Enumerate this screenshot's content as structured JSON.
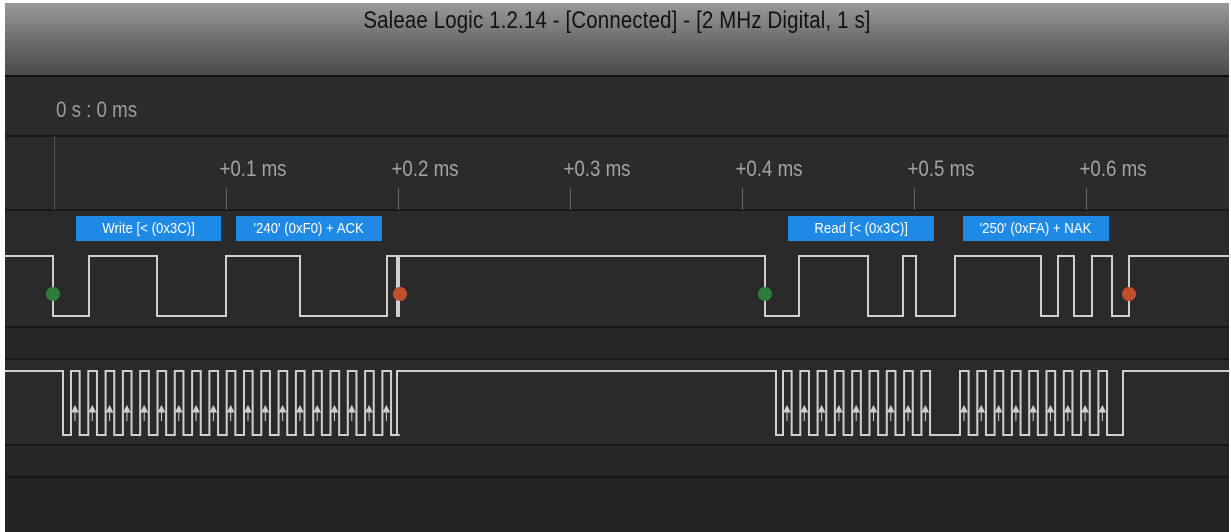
{
  "window": {
    "title": "Saleae Logic 1.2.14 - [Connected] - [2 MHz Digital, 1 s]"
  },
  "timeline": {
    "origin_label": "0 s : 0 ms",
    "ticks": [
      "+0.1 ms",
      "+0.2 ms",
      "+0.3 ms",
      "+0.4 ms",
      "+0.5 ms",
      "+0.6 ms"
    ]
  },
  "protocol": "I2C",
  "frames": [
    {
      "label": "Write [< (0x3C)]",
      "color": "#1f8ae6"
    },
    {
      "label": "'240' (0xF0) + ACK",
      "color": "#1f8ae6"
    },
    {
      "label": "Read [< (0x3C)]",
      "color": "#1f8ae6"
    },
    {
      "label": "'250' (0xFA) + NAK",
      "color": "#1f8ae6"
    }
  ],
  "markers": {
    "start_color": "#2e7d3c",
    "stop_color": "#c0502c"
  },
  "colors": {
    "background": "#1f1f1f",
    "channel_bg": "#2a2a2a",
    "waveform": "#cfcfcf",
    "label_bg": "#1f8ae6",
    "title_text": "#111111",
    "axis_text": "#a3a3a3"
  }
}
